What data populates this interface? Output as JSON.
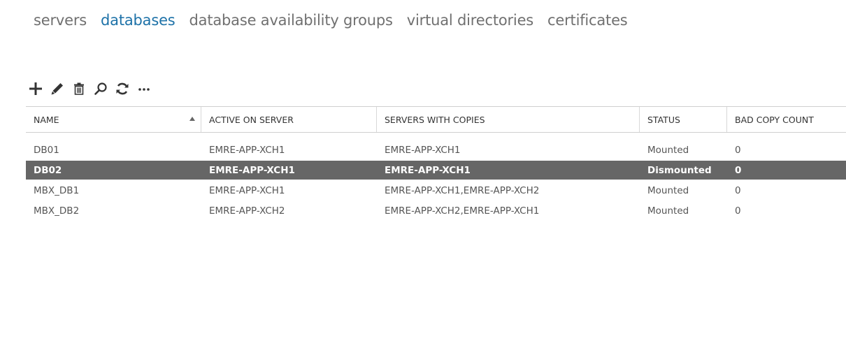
{
  "tabs": [
    {
      "label": "servers",
      "active": false
    },
    {
      "label": "databases",
      "active": true
    },
    {
      "label": "database availability groups",
      "active": false
    },
    {
      "label": "virtual directories",
      "active": false
    },
    {
      "label": "certificates",
      "active": false
    }
  ],
  "toolbar": {
    "icons": [
      "add-icon",
      "edit-icon",
      "delete-icon",
      "search-icon",
      "refresh-icon",
      "more-icon"
    ]
  },
  "grid": {
    "columns": [
      "NAME",
      "ACTIVE ON SERVER",
      "SERVERS WITH COPIES",
      "STATUS",
      "BAD COPY COUNT"
    ],
    "sort_column": "NAME",
    "sort_direction": "ascending",
    "rows": [
      {
        "name": "DB01",
        "active_on_server": "EMRE-APP-XCH1",
        "servers_with_copies": "EMRE-APP-XCH1",
        "status": "Mounted",
        "bad_copy_count": "0",
        "selected": false
      },
      {
        "name": "DB02",
        "active_on_server": "EMRE-APP-XCH1",
        "servers_with_copies": "EMRE-APP-XCH1",
        "status": "Dismounted",
        "bad_copy_count": "0",
        "selected": true
      },
      {
        "name": "MBX_DB1",
        "active_on_server": "EMRE-APP-XCH1",
        "servers_with_copies": "EMRE-APP-XCH1,EMRE-APP-XCH2",
        "status": "Mounted",
        "bad_copy_count": "0",
        "selected": false
      },
      {
        "name": "MBX_DB2",
        "active_on_server": "EMRE-APP-XCH2",
        "servers_with_copies": "EMRE-APP-XCH2,EMRE-APP-XCH1",
        "status": "Mounted",
        "bad_copy_count": "0",
        "selected": false
      }
    ]
  },
  "colors": {
    "accent": "#1e72a8",
    "tab_inactive": "#707070",
    "selected_row_bg": "#666666",
    "selected_row_text": "#ffffff"
  }
}
